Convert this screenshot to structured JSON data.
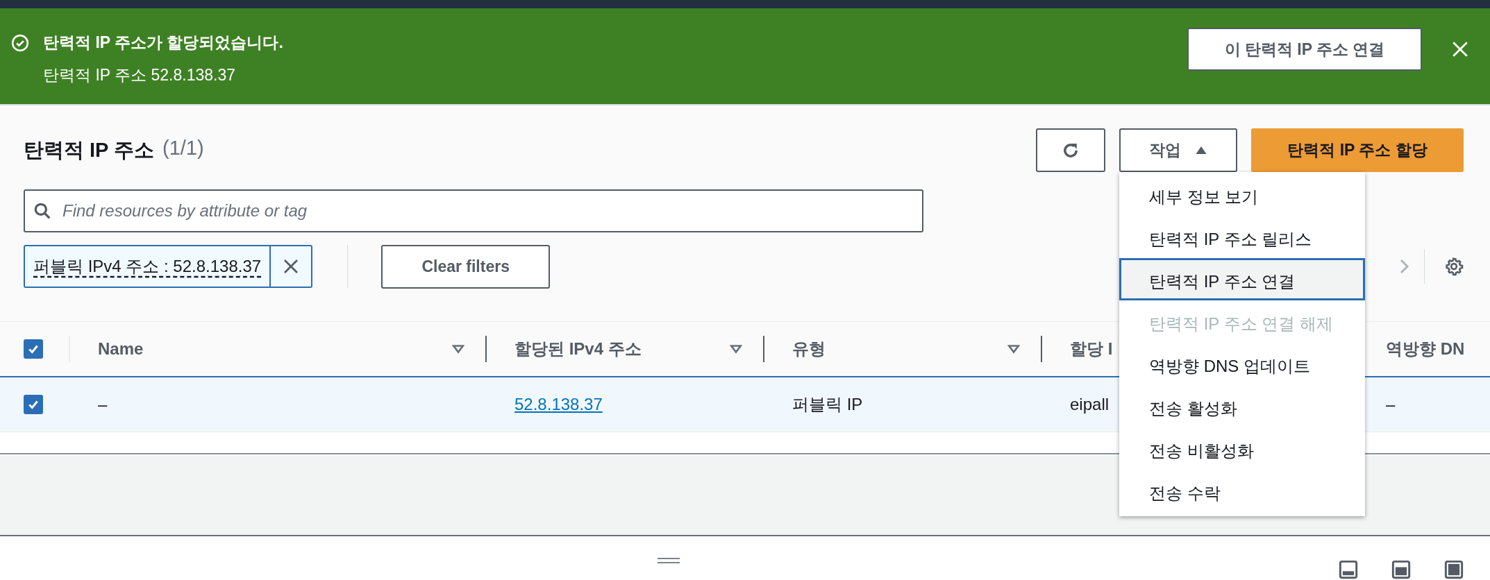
{
  "banner": {
    "title": "탄력적 IP 주소가 할당되었습니다.",
    "message": "탄력적 IP 주소 52.8.138.37",
    "action": "이 탄력적 IP 주소 연결"
  },
  "header": {
    "title": "탄력적 IP 주소",
    "count": "(1/1)",
    "actions_button": "작업",
    "menu_expanded": true,
    "primary_button": "탄력적 IP 주소 할당"
  },
  "search": {
    "placeholder": "Find resources by attribute or tag"
  },
  "filter": {
    "label": "퍼블릭 IPv4 주소 : 52.8.138.37"
  },
  "clear_filters": "Clear filters",
  "menu": [
    {
      "label": "세부 정보 보기",
      "selected": false,
      "disabled": false
    },
    {
      "label": "탄력적 IP 주소 릴리스",
      "selected": false,
      "disabled": false
    },
    {
      "label": "탄력적 IP 주소 연결",
      "selected": true,
      "disabled": false
    },
    {
      "label": "탄력적 IP 주소 연결 해제",
      "selected": false,
      "disabled": true
    },
    {
      "label": "역방향 DNS 업데이트",
      "selected": false,
      "disabled": false
    },
    {
      "label": "전송 활성화",
      "selected": false,
      "disabled": false
    },
    {
      "label": "전송 비활성화",
      "selected": false,
      "disabled": false
    },
    {
      "label": "전송 수락",
      "selected": false,
      "disabled": false
    }
  ],
  "table": {
    "all_checked": true,
    "columns": [
      {
        "label": "Name",
        "sortable": true
      },
      {
        "label": "할당된 IPv4 주소",
        "sortable": true
      },
      {
        "label": "유형",
        "sortable": true
      },
      {
        "label": "할당 I",
        "sortable": false
      },
      {
        "label": "역방향 DN",
        "sortable": false
      }
    ],
    "rows": [
      {
        "selected": true,
        "checked": true,
        "cells": [
          {
            "text": "–",
            "link": false
          },
          {
            "text": "52.8.138.37",
            "link": true
          },
          {
            "text": "퍼블릭 IP",
            "link": false
          },
          {
            "text": "eipall",
            "link": false
          },
          {
            "text": "–",
            "link": false
          }
        ]
      }
    ]
  }
}
